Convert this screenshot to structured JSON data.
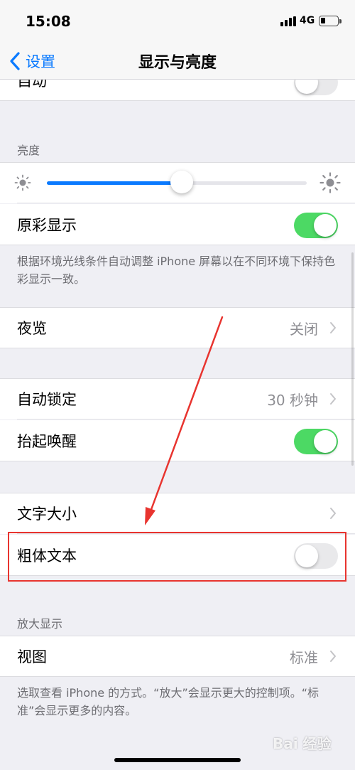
{
  "status_bar": {
    "time": "15:08",
    "network": "4G"
  },
  "nav": {
    "back_label": "设置",
    "title": "显示与亮度"
  },
  "rows": {
    "auto": {
      "label": "自动",
      "toggle_on": false
    },
    "true_tone": {
      "label": "原彩显示",
      "toggle_on": true
    },
    "night_shift": {
      "label": "夜览",
      "value": "关闭"
    },
    "auto_lock": {
      "label": "自动锁定",
      "value": "30 秒钟"
    },
    "raise_to_wake": {
      "label": "抬起唤醒",
      "toggle_on": true
    },
    "text_size": {
      "label": "文字大小"
    },
    "bold_text": {
      "label": "粗体文本",
      "toggle_on": false
    },
    "view": {
      "label": "视图",
      "value": "标准"
    }
  },
  "brightness": {
    "header": "亮度",
    "level": 0.52
  },
  "true_tone_footer": "根据环境光线条件自动调整 iPhone 屏幕以在不同环境下保持色彩显示一致。",
  "zoom_header": "放大显示",
  "zoom_footer": "选取查看 iPhone 的方式。“放大”会显示更大的控制项。“标准”会显示更多的内容。",
  "watermark": "Bai 经验",
  "colors": {
    "accent": "#0a7aff",
    "toggle_on": "#4cd964",
    "annotation": "#e8342f"
  },
  "icons": [
    "back-chevron-icon",
    "sun-small-icon",
    "sun-large-icon",
    "chevron-right-icon"
  ]
}
